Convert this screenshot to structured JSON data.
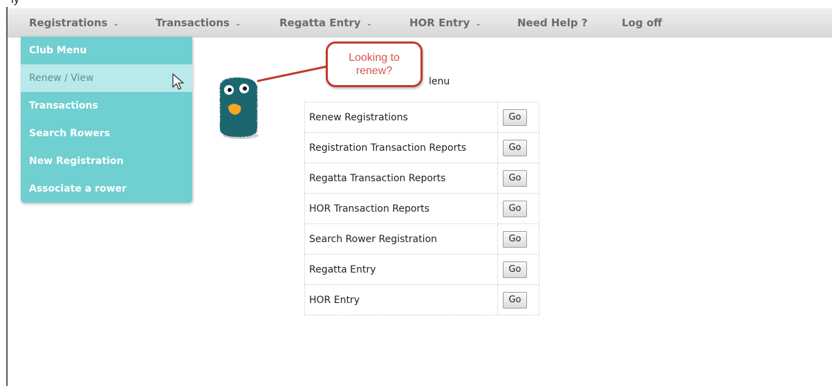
{
  "header_fragment": "ly",
  "navbar": {
    "items": [
      {
        "label": "Registrations",
        "chevron": "⌄"
      },
      {
        "label": "Transactions",
        "chevron": "⌄"
      },
      {
        "label": "Regatta Entry",
        "chevron": "⌄"
      },
      {
        "label": "HOR Entry",
        "chevron": "⌄"
      },
      {
        "label": "Need Help ?"
      },
      {
        "label": "Log off"
      }
    ]
  },
  "sidebar": {
    "items": [
      {
        "label": "Club Menu"
      },
      {
        "label": "Renew / View",
        "active": true
      },
      {
        "label": "Transactions"
      },
      {
        "label": "Search Rowers"
      },
      {
        "label": "New Registration"
      },
      {
        "label": "Associate a rower"
      }
    ]
  },
  "callout": {
    "text_line1": "Looking to",
    "text_line2": "renew?"
  },
  "main": {
    "heading_fragment": "lenu"
  },
  "table": {
    "button_label": "Go",
    "rows": [
      {
        "label": "Renew Registrations"
      },
      {
        "label": "Registration Transaction Reports"
      },
      {
        "label": "Regatta Transaction Reports"
      },
      {
        "label": "HOR Transaction Reports"
      },
      {
        "label": "Search Rower Registration"
      },
      {
        "label": "Regatta Entry"
      },
      {
        "label": "HOR Entry"
      }
    ]
  },
  "colors": {
    "sidebar_bg": "#6fcfd1",
    "sidebar_active_bg": "#b9e9ea",
    "callout_border": "#c0392b",
    "callout_text": "#d9534f",
    "mascot": "#1f6670"
  },
  "icons": {
    "cursor": "mouse-pointer-icon",
    "mascot": "monster-mascot"
  }
}
